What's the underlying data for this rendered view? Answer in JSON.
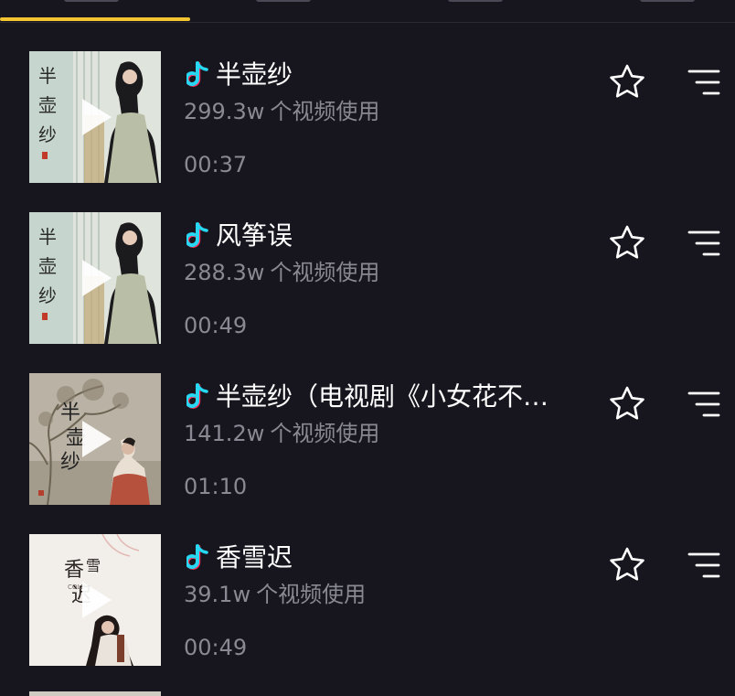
{
  "tabs": {
    "active_index": 0,
    "indicator_color": "#f4c430"
  },
  "songs": [
    {
      "title": "半壶纱",
      "usage_count": "299.3w",
      "usage_suffix": "个视频使用",
      "duration": "00:37",
      "cover_style": "a",
      "cover_calligraphy": "半壶纱",
      "note_color": "#28d7f2"
    },
    {
      "title": "风筝误",
      "usage_count": "288.3w",
      "usage_suffix": "个视频使用",
      "duration": "00:49",
      "cover_style": "a",
      "cover_calligraphy": "半壶纱",
      "note_color": "#28d7f2"
    },
    {
      "title": "半壶纱（电视剧《小女花不…",
      "usage_count": "141.2w",
      "usage_suffix": "个视频使用",
      "duration": "01:10",
      "cover_style": "b",
      "cover_calligraphy": "半壶纱",
      "note_color": "#28d7f2"
    },
    {
      "title": "香雪迟",
      "usage_count": "39.1w",
      "usage_suffix": "个视频使用",
      "duration": "00:49",
      "cover_style": "c",
      "cover_calligraphy": "香雪迟",
      "note_color": "#28d7f2"
    }
  ],
  "icons": {
    "note": "music-note-icon",
    "favorite": "star-outline-icon",
    "menu": "sort-lines-icon",
    "play": "play-icon"
  },
  "colors": {
    "background": "#17161f",
    "title_text": "#ffffff",
    "secondary_text": "#8a8993"
  }
}
